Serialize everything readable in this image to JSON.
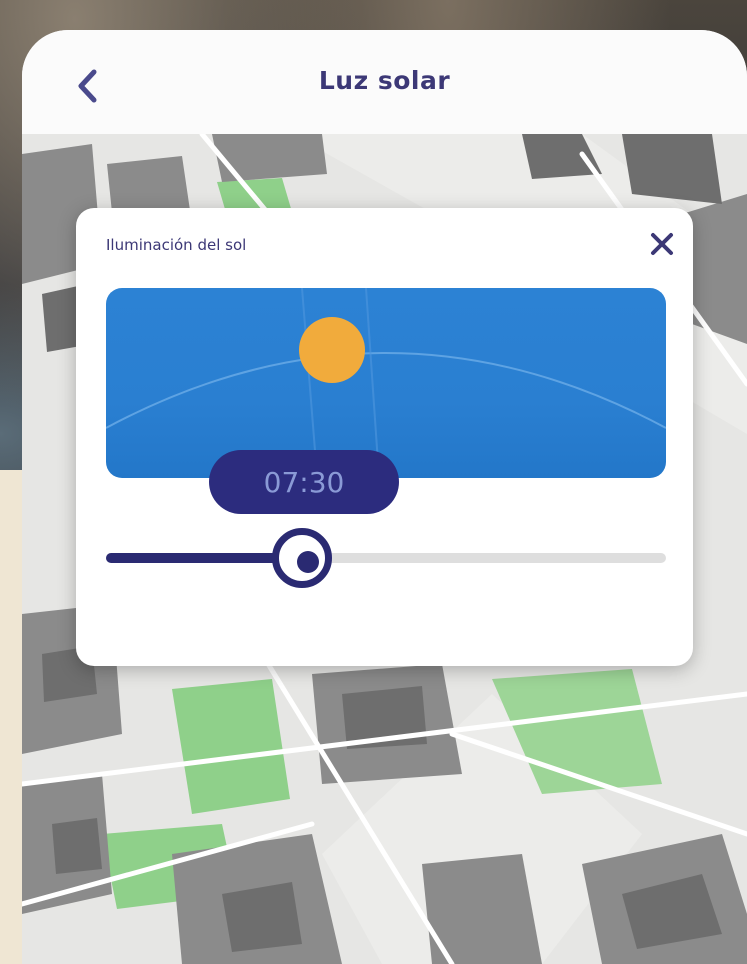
{
  "header": {
    "title": "Luz solar",
    "back_icon": "chevron-left-icon"
  },
  "sun_panel": {
    "title": "Iluminación del sol",
    "close_icon": "close-icon",
    "time": "07:30",
    "slider_value": 0.35
  },
  "colors": {
    "brand_navy": "#2a2a72",
    "sky_blue": "#2a7fd1",
    "sun_orange": "#f1ab3c",
    "park_green": "#8fd08a"
  }
}
